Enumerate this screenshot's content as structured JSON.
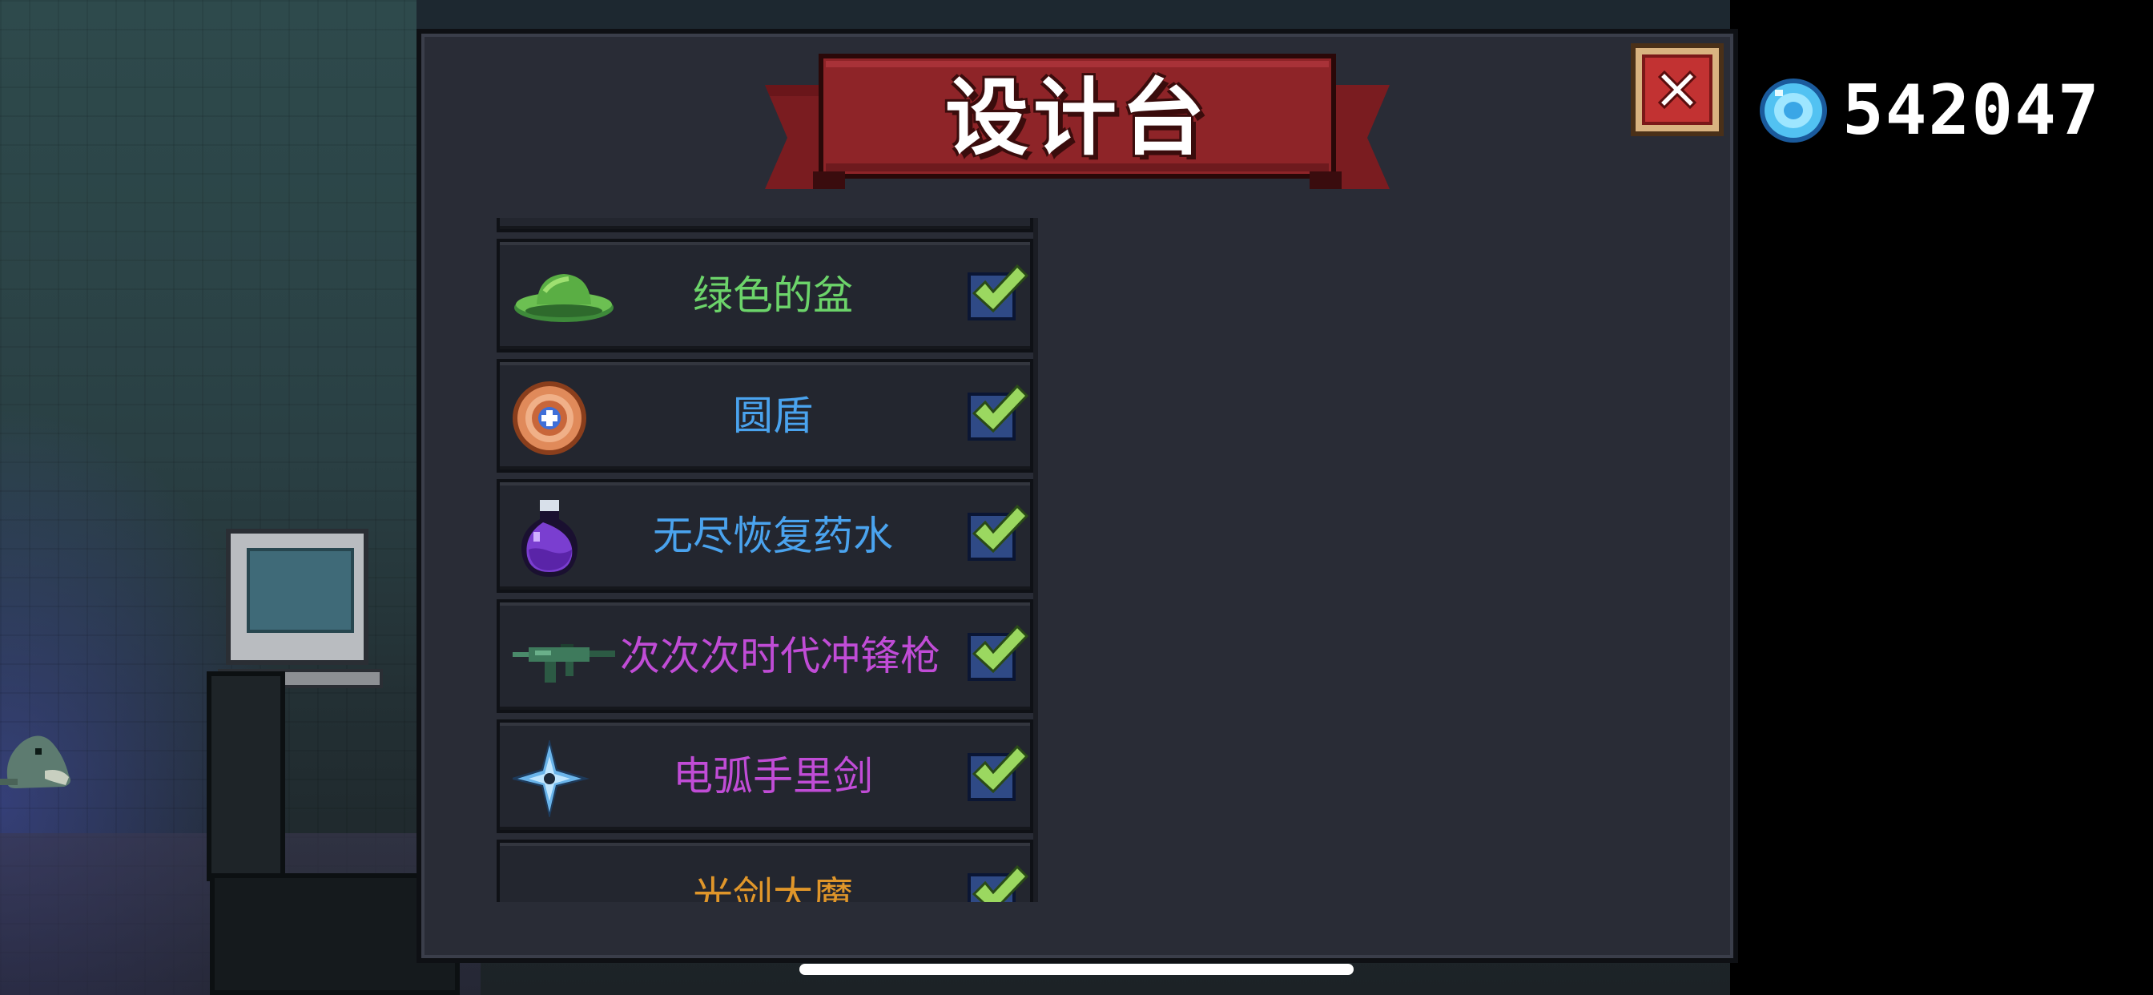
{
  "title": "设计台",
  "currency": {
    "icon": "blue-gem-icon",
    "value": "542047"
  },
  "close": {
    "icon": "close-x-icon"
  },
  "items": [
    {
      "label": "",
      "color": "#5aa0e8",
      "icon": "partial-blue-item-icon",
      "checked": true
    },
    {
      "label": "绿色的盆",
      "color": "#6cd46a",
      "icon": "green-basin-icon",
      "checked": true
    },
    {
      "label": "圆盾",
      "color": "#4aa3ee",
      "icon": "round-shield-icon",
      "checked": true
    },
    {
      "label": "无尽恢复药水",
      "color": "#4aa3ee",
      "icon": "purple-potion-icon",
      "checked": true
    },
    {
      "label": "次次次时代冲锋枪",
      "color": "#c04cd6",
      "icon": "submachine-gun-icon",
      "checked": true
    },
    {
      "label": "电弧手里剑",
      "color": "#c04cd6",
      "icon": "shuriken-icon",
      "checked": true
    },
    {
      "label": "光剑大魔",
      "color": "#e0962a",
      "icon": "partial-orange-item-icon",
      "checked": true
    }
  ],
  "colors": {
    "banner_red": "#8e2428",
    "panel_bg": "#292c36",
    "check_green": "#9bd860",
    "check_box": "#2f4a86"
  }
}
